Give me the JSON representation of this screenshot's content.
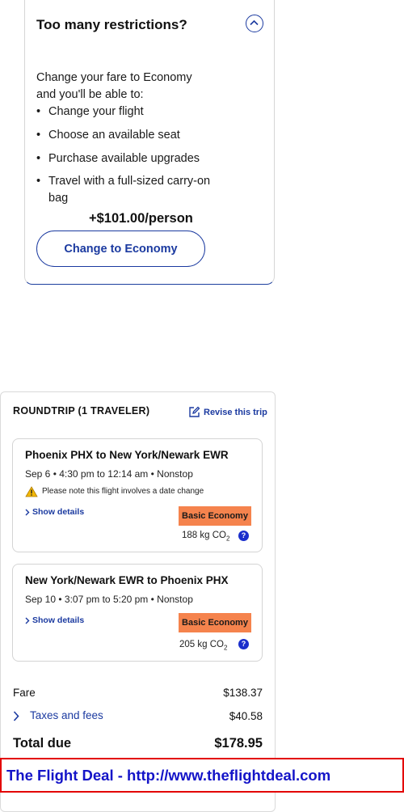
{
  "upsell": {
    "title": "Too many restrictions?",
    "intro": "Change your fare to Economy and you'll be able to:",
    "benefits": [
      "Change your flight",
      "Choose an available seat",
      "Purchase available upgrades",
      "Travel with a full-sized carry-on bag"
    ],
    "price": "+$101.00/person",
    "button_label": "Change to Economy"
  },
  "trip": {
    "header": "ROUNDTRIP (1 TRAVELER)",
    "revise_label": "Revise this trip",
    "flights": [
      {
        "route": "Phoenix PHX to New York/Newark EWR",
        "times": "Sep 6 • 4:30 pm to 12:14 am • Nonstop",
        "warning": "Please note this flight involves a date change",
        "details_label": "Show details",
        "fare_class": "Basic Economy",
        "co2_value": "188 kg CO",
        "co2_sub": "2"
      },
      {
        "route": "New York/Newark EWR to Phoenix PHX",
        "times": "Sep 10 • 3:07 pm to 5:20 pm • Nonstop",
        "details_label": "Show details",
        "fare_class": "Basic Economy",
        "co2_value": "205 kg CO",
        "co2_sub": "2"
      }
    ]
  },
  "summary": {
    "fare_label": "Fare",
    "fare_value": "$138.37",
    "taxes_label": "Taxes and fees",
    "taxes_value": "$40.58",
    "total_label": "Total due",
    "total_value": "$178.95"
  },
  "watermark": "The Flight Deal - http://www.theflightdeal.com",
  "icons": {
    "collapse": "chevron-up-icon",
    "revise": "edit-icon",
    "warning": "warning-icon",
    "expand": "chevron-right-icon",
    "help": "question-icon"
  },
  "colors": {
    "accent": "#1b3aa0",
    "fare_badge": "#f5834d",
    "help_icon": "#1b2fcc",
    "watermark_border": "#e30000",
    "watermark_text": "#1414c8"
  }
}
